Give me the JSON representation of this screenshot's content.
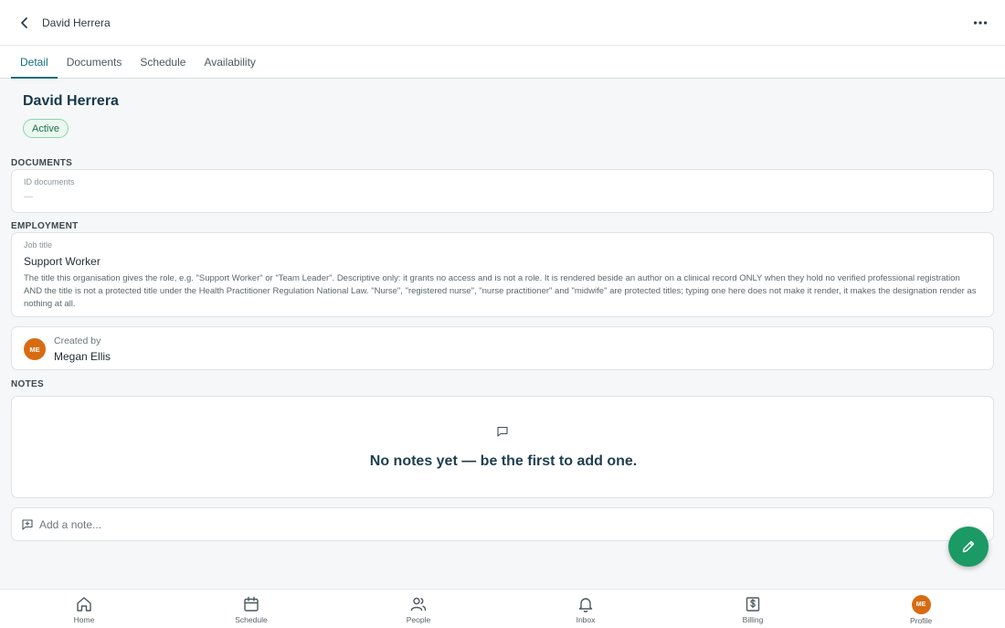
{
  "header": {
    "title": "David Herrera"
  },
  "tabs": [
    {
      "label": "Detail",
      "active": true
    },
    {
      "label": "Documents",
      "active": false
    },
    {
      "label": "Schedule",
      "active": false
    },
    {
      "label": "Availability",
      "active": false
    }
  ],
  "profile": {
    "name": "David Herrera",
    "status": "Active"
  },
  "documents": {
    "section_label": "DOCUMENTS",
    "id_documents_label": "ID documents",
    "id_documents_value": "—"
  },
  "employment": {
    "section_label": "EMPLOYMENT",
    "job_title_label": "Job title",
    "job_title_value": "Support Worker",
    "help_text": "The title this organisation gives the role, e.g. \"Support Worker\" or \"Team Leader\". Descriptive only: it grants no access and is not a role. It is rendered beside an author on a clinical record ONLY when they hold no verified professional registration AND the title is not a protected title under the Health Practitioner Regulation National Law. \"Nurse\", \"registered nurse\", \"nurse practitioner\" and \"midwife\" are protected titles; typing one here does not make it render, it makes the designation render as nothing at all."
  },
  "created_by": {
    "label": "Created by",
    "initials": "ME",
    "name": "Megan Ellis"
  },
  "notes": {
    "section_label": "NOTES",
    "empty_message": "No notes yet — be the first to add one.",
    "add_placeholder": "Add a note..."
  },
  "bottom_nav": [
    {
      "label": "Home",
      "icon": "home-icon"
    },
    {
      "label": "Schedule",
      "icon": "calendar-icon"
    },
    {
      "label": "People",
      "icon": "people-icon"
    },
    {
      "label": "Inbox",
      "icon": "bell-icon"
    },
    {
      "label": "Billing",
      "icon": "billing-icon"
    },
    {
      "label": "Profile",
      "icon": "avatar",
      "initials": "ME"
    }
  ],
  "colors": {
    "accent": "#13707a",
    "fab": "#1b9a66",
    "avatar": "#d86b12",
    "status_bg": "#eaf8f0",
    "status_border": "#8fd3b0"
  }
}
